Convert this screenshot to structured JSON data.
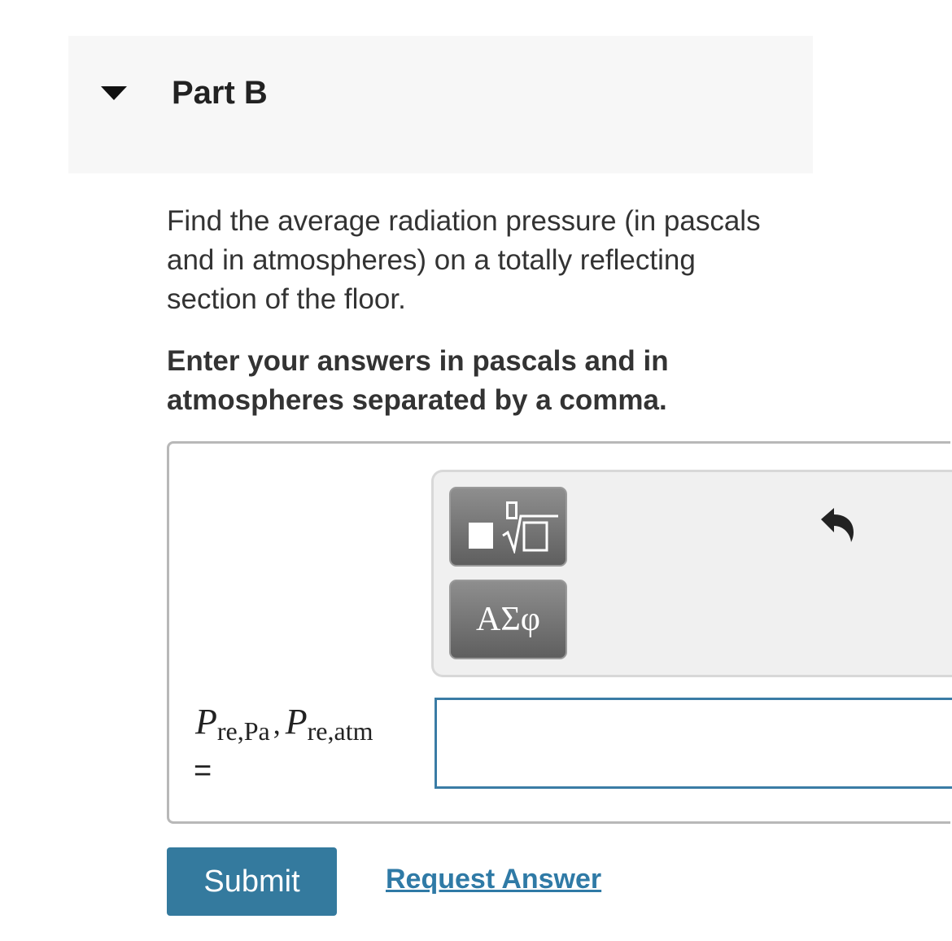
{
  "part": {
    "title": "Part B",
    "caret_icon": "caret-down-icon"
  },
  "question": {
    "text": "Find the average radiation pressure (in pascals and in atmospheres) on a totally reflecting section of the floor.",
    "instruction": "Enter your answers in pascals and in atmospheres separated by a comma."
  },
  "toolbar": {
    "templates_icon": "math-templates-icon",
    "symbols_label": "ΑΣφ",
    "undo_icon": "undo-icon"
  },
  "equation": {
    "var1": "P",
    "sub1": "re,Pa",
    "separator": ",",
    "var2": "P",
    "sub2": "re,atm",
    "equals": "="
  },
  "answer": {
    "value": "",
    "placeholder": ""
  },
  "actions": {
    "submit_label": "Submit",
    "request_label": "Request Answer"
  },
  "colors": {
    "submit_bg": "#347a9e",
    "link": "#2f7aa6",
    "input_border": "#3a7ca5",
    "header_bg": "#f7f7f7"
  }
}
